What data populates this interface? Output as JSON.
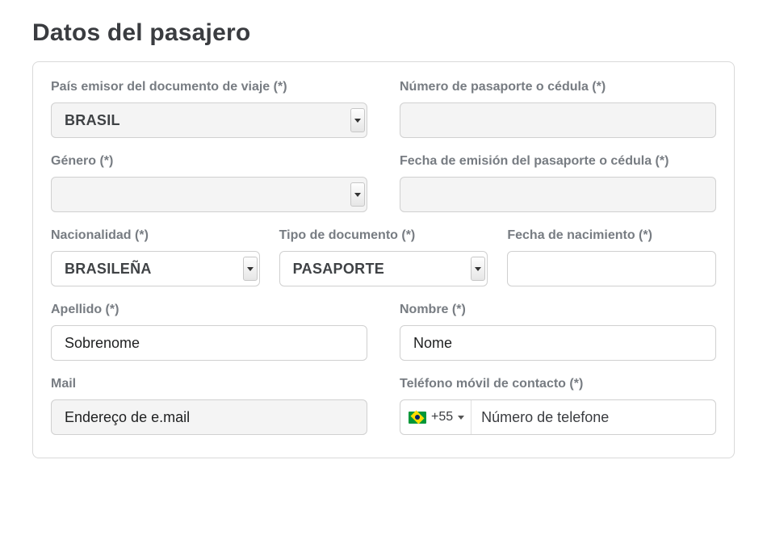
{
  "heading": "Datos del pasajero",
  "fields": {
    "issuingCountry": {
      "label": "País emisor del documento de viaje (*)",
      "value": "BRASIL"
    },
    "passportNumber": {
      "label": "Número de pasaporte o cédula (*)",
      "value": ""
    },
    "gender": {
      "label": "Género (*)",
      "value": ""
    },
    "issueDate": {
      "label": "Fecha de emisión del pasaporte o cédula (*)",
      "value": ""
    },
    "nationality": {
      "label": "Nacionalidad (*)",
      "value": "BRASILEÑA"
    },
    "docType": {
      "label": "Tipo de documento (*)",
      "value": "PASAPORTE"
    },
    "birthDate": {
      "label": "Fecha de nacimiento (*)",
      "value": ""
    },
    "lastName": {
      "label": "Apellido (*)",
      "value": "Sobrenome"
    },
    "firstName": {
      "label": "Nombre (*)",
      "value": "Nome"
    },
    "email": {
      "label": "Mail",
      "value": "Endereço de e.mail"
    },
    "phone": {
      "label": "Teléfono móvil de contacto (*)",
      "dialCode": "+55",
      "placeholder": "Número de telefone"
    }
  }
}
